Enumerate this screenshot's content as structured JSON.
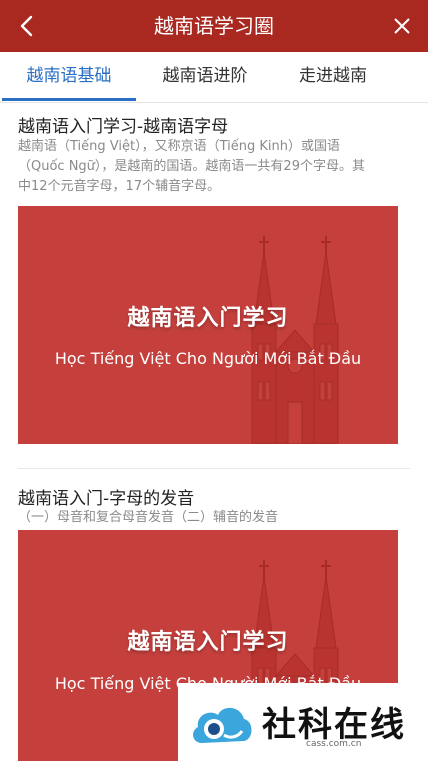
{
  "header": {
    "title": "越南语学习圈",
    "back_icon": "chevron-left-icon",
    "close_icon": "close-icon"
  },
  "tabs": [
    {
      "label": "越南语基础",
      "active": true
    },
    {
      "label": "越南语进阶",
      "active": false
    },
    {
      "label": "走进越南",
      "active": false
    }
  ],
  "articles": [
    {
      "title": "越南语入门学习-越南语字母",
      "desc_line1": "越南语（Tiếng Việt），又称京语（Tiếng Kinh）或国语",
      "desc_line2": "（Quốc Ngữ），是越南的国语。越南语一共有29个字母。其",
      "desc_line3": "中12个元音字母，17个辅音字母。",
      "banner": {
        "title": "越南语入门学习",
        "subtitle": "Học Tiếng Việt Cho Người Mới Bắt Đầu"
      }
    },
    {
      "title": "越南语入门-字母的发音",
      "desc_line1": "（一）母音和复合母音发音（二）辅音的发音",
      "banner": {
        "title": "越南语入门学习",
        "subtitle": "Học Tiếng Việt Cho Người Mới Bắt Đầu"
      }
    }
  ],
  "watermark": {
    "text": "社科在线",
    "url": "cass.com.cn"
  },
  "colors": {
    "header_bg": "#a9281f",
    "active_tab": "#2a6fc4",
    "banner_bg": "#c5403d"
  }
}
